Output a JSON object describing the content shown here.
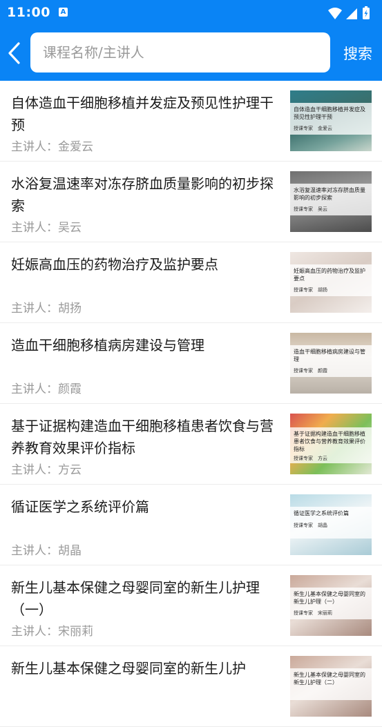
{
  "status_bar": {
    "time": "11:00",
    "badge": "A"
  },
  "header": {
    "search_placeholder": "课程名称/主讲人",
    "search_button": "搜索"
  },
  "colors": {
    "accent": "#0a84f5"
  },
  "courses": [
    {
      "title": "自体造血干细胞移植并发症及预见性护理干预",
      "speaker": "主讲人：金爱云",
      "thumb_title": "自体造血干细胞移植并发症及预见性护理干预",
      "thumb_sub": "授课专家　金爱云"
    },
    {
      "title": "水浴复温速率对冻存脐血质量影响的初步探索",
      "speaker": "主讲人：吴云",
      "thumb_title": "水浴复温速率对冻存脐血质量影响的初步探索",
      "thumb_sub": "授课专家　吴云"
    },
    {
      "title": "妊娠高血压的药物治疗及监护要点",
      "speaker": "主讲人：胡扬",
      "thumb_title": "妊娠高血压的药物治疗及监护要点",
      "thumb_sub": "授课专家　胡扬"
    },
    {
      "title": "造血干细胞移植病房建设与管理",
      "speaker": "主讲人：颜霞",
      "thumb_title": "造血干细胞移植病房建设与管理",
      "thumb_sub": "授课专家　颜霞"
    },
    {
      "title": "基于证据构建造血干细胞移植患者饮食与营养教育效果评价指标",
      "speaker": "主讲人：方云",
      "thumb_title": "基于证据构建造血干细胞移植患者饮食与营养教育效果评价指标",
      "thumb_sub": "授课专家　方云"
    },
    {
      "title": "循证医学之系统评价篇",
      "speaker": "主讲人：胡晶",
      "thumb_title": "循证医学之系统评价篇",
      "thumb_sub": "授课专家　胡晶"
    },
    {
      "title": "新生儿基本保健之母婴同室的新生儿护理（一）",
      "speaker": "主讲人：宋丽莉",
      "thumb_title": "新生儿基本保健之母婴同室的新生儿护理（一）",
      "thumb_sub": "授课专家　宋丽莉"
    },
    {
      "title": "新生儿基本保健之母婴同室的新生儿护",
      "speaker": "",
      "thumb_title": "新生儿基本保健之母婴同室的新生儿护理（二）",
      "thumb_sub": ""
    }
  ]
}
